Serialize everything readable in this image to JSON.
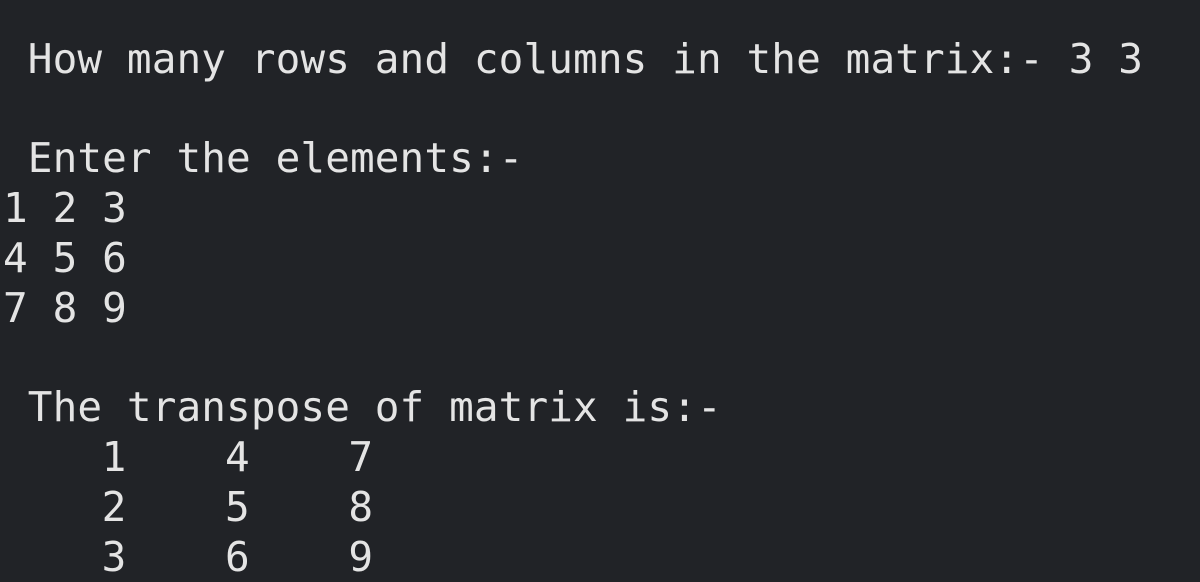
{
  "terminal": {
    "prompt_rows_cols": " How many rows and columns in the matrix:- ",
    "input_rows_cols": "3 3",
    "prompt_elements": " Enter the elements:-",
    "input_matrix": [
      "1 2 3",
      "4 5 6",
      "7 8 9"
    ],
    "result_label": " The transpose of matrix is:-",
    "transpose": [
      [
        "1",
        "4",
        "7"
      ],
      [
        "2",
        "5",
        "8"
      ],
      [
        "3",
        "6",
        "9"
      ]
    ]
  }
}
